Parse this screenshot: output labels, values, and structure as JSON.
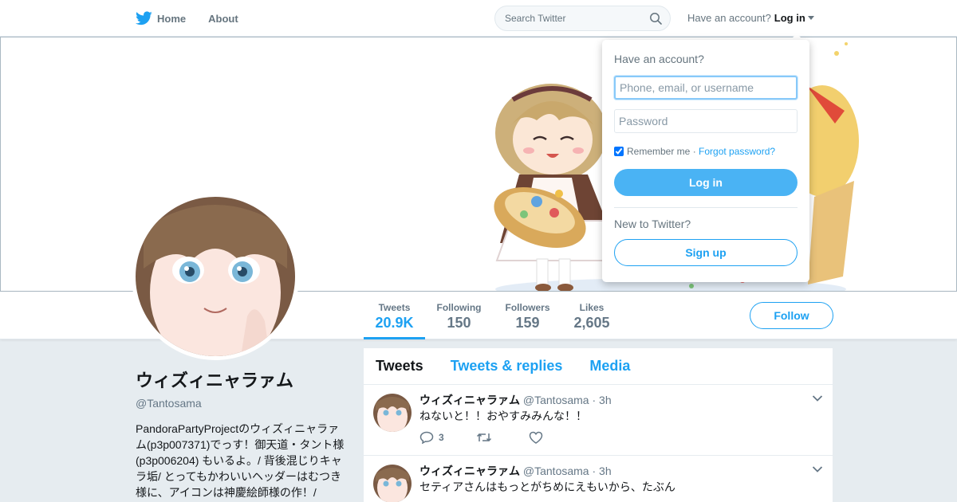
{
  "nav": {
    "home_label": "Home",
    "about_label": "About",
    "search_placeholder": "Search Twitter",
    "account_prompt": "Have an account?",
    "login_label": "Log in"
  },
  "profile": {
    "display_name": "ウィズィニャラァム",
    "handle": "@Tantosama",
    "bio": "PandoraPartyProjectのウィズィニャラァム(p3p007371)でっす！御天道・タント様(p3p006204) もいるよ。/ 背後混じりキャラ垢/ とってもかわいいヘッダーはむつき様に、アイコンは神慶絵師様の作！/ 『PandoraPartyProject』（C）ウィズィ/"
  },
  "stats": [
    {
      "label": "Tweets",
      "value": "20.9K",
      "active": true
    },
    {
      "label": "Following",
      "value": "150"
    },
    {
      "label": "Followers",
      "value": "159"
    },
    {
      "label": "Likes",
      "value": "2,605"
    }
  ],
  "follow_label": "Follow",
  "timeline": {
    "tabs": [
      "Tweets",
      "Tweets & replies",
      "Media"
    ],
    "tweets": [
      {
        "name": "ウィズィニャラァム",
        "handle": "@Tantosama",
        "time": "· 3h",
        "text": "ねないと！！おやすみみんな！！",
        "replies": "3"
      },
      {
        "name": "ウィズィニャラァム",
        "handle": "@Tantosama",
        "time": "· 3h",
        "text": "セティアさんはもっとがちめにえもいから、たぶん",
        "replies": ""
      }
    ]
  },
  "login_dropdown": {
    "title": "Have an account?",
    "username_placeholder": "Phone, email, or username",
    "password_placeholder": "Password",
    "remember_label": "Remember me",
    "separator": " · ",
    "forgot_label": "Forgot password?",
    "login_button": "Log in",
    "new_prompt": "New to Twitter?",
    "signup_button": "Sign up"
  },
  "colors": {
    "brand": "#1da1f2",
    "login_button_bg": "#4ab3f4",
    "page_bg": "#e6ecf0"
  }
}
